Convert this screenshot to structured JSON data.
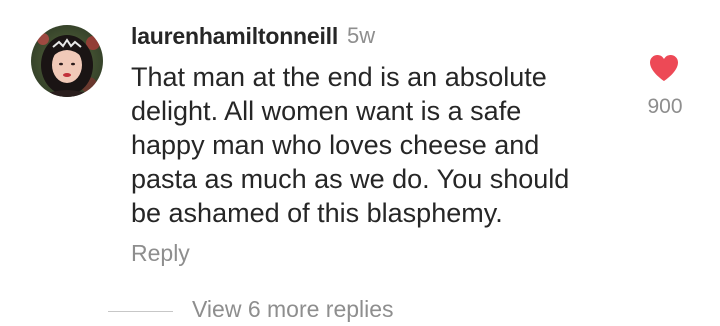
{
  "comment": {
    "username": "laurenhamiltonneill",
    "time": "5w",
    "text": "That man at the end is an absolute delight. All women want is a safe happy man who loves cheese and pasta as much as we do. You should be ashamed of this blasphemy.",
    "reply_label": "Reply",
    "like_count": "900",
    "like_color": "#ed4956",
    "view_more_label": "View 6 more replies",
    "avatar_icon": "user-avatar",
    "like_icon": "heart-icon"
  }
}
